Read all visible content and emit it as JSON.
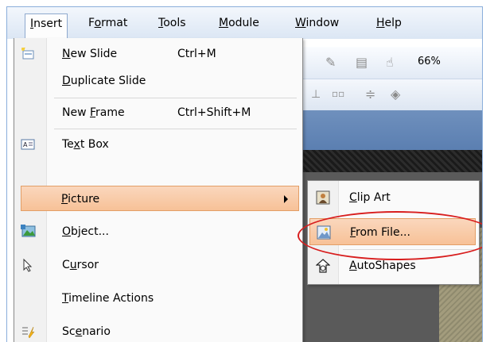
{
  "menubar": {
    "items": [
      {
        "label": "Insert",
        "mnemonic": "I",
        "rest": "nsert"
      },
      {
        "label": "Format",
        "mnemonic": "o",
        "pre": "F",
        "rest": "rmat"
      },
      {
        "label": "Tools",
        "mnemonic": "T",
        "rest": "ools"
      },
      {
        "label": "Module",
        "mnemonic": "M",
        "rest": "odule"
      },
      {
        "label": "Window",
        "mnemonic": "W",
        "rest": "indow"
      },
      {
        "label": "Help",
        "mnemonic": "H",
        "rest": "elp"
      }
    ]
  },
  "toolbar": {
    "zoom": "66%"
  },
  "insert_menu": {
    "new_slide": {
      "pre": "",
      "u": "N",
      "post": "ew Slide",
      "shortcut": "Ctrl+M"
    },
    "duplicate_slide": {
      "pre": "",
      "u": "D",
      "post": "uplicate Slide"
    },
    "new_frame": {
      "pre": "New ",
      "u": "F",
      "post": "rame",
      "shortcut": "Ctrl+Shift+M"
    },
    "text_box": {
      "pre": "Te",
      "u": "x",
      "post": "t Box"
    },
    "picture": {
      "pre": "",
      "u": "P",
      "post": "icture"
    },
    "object": {
      "pre": "",
      "u": "O",
      "post": "bject..."
    },
    "cursor": {
      "pre": "C",
      "u": "u",
      "post": "rsor"
    },
    "timeline_actions": {
      "pre": "",
      "u": "T",
      "post": "imeline Actions"
    },
    "scenario": {
      "pre": "Sc",
      "u": "e",
      "post": "nario"
    }
  },
  "picture_submenu": {
    "clip_art": {
      "pre": "",
      "u": "C",
      "post": "lip Art"
    },
    "from_file": {
      "pre": "",
      "u": "F",
      "post": "rom File..."
    },
    "autoshapes": {
      "pre": "",
      "u": "A",
      "post": "utoShapes"
    }
  },
  "colors": {
    "highlight": "#f7c197",
    "highlight_border": "#e39e66",
    "callout": "#d81e1e"
  }
}
